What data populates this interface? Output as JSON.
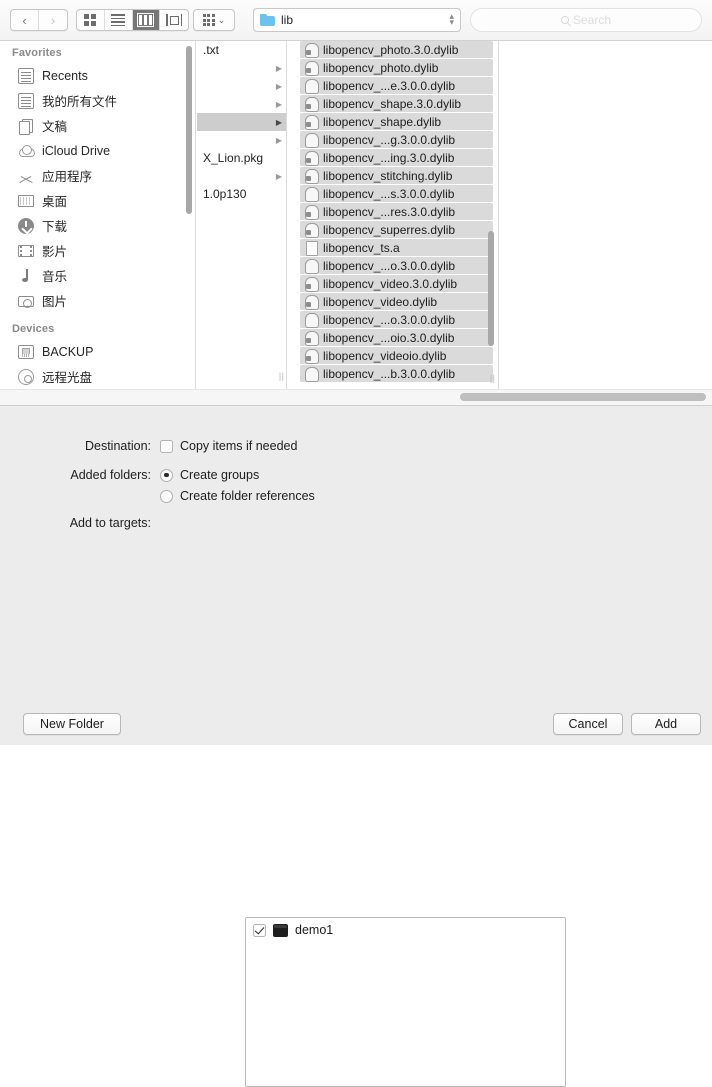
{
  "toolbar": {
    "nav": [
      {
        "name": "back-button",
        "glyph": "‹",
        "enabled": true
      },
      {
        "name": "forward-button",
        "glyph": "›",
        "enabled": false
      }
    ],
    "view_modes": [
      {
        "name": "icon-view-button",
        "icon": "icon-grid-icon",
        "selected": false
      },
      {
        "name": "list-view-button",
        "icon": "list-lines-icon",
        "selected": false
      },
      {
        "name": "column-view-button",
        "icon": "columns-icon",
        "selected": true
      },
      {
        "name": "coverflow-view-button",
        "icon": "coverflow-icon",
        "selected": false
      }
    ],
    "action_menu": {
      "name": "action-menu-button",
      "icon": "grid-dots-icon",
      "caret": "⌄"
    },
    "path": {
      "label": "lib",
      "icon": "folder-icon",
      "stepper_up": "▴",
      "stepper_down": "▾"
    },
    "search": {
      "placeholder": "Search",
      "icon": "search-icon"
    }
  },
  "sidebar": {
    "sections": [
      {
        "header": "Favorites",
        "items": [
          {
            "label": "Recents",
            "icon": "recents-icon",
            "shape": "gi-clock"
          },
          {
            "label": "我的所有文件",
            "icon": "all-files-icon",
            "shape": "gi-docs"
          },
          {
            "label": "文稿",
            "icon": "documents-icon",
            "shape": "gi-doc"
          },
          {
            "label": "iCloud Drive",
            "icon": "icloud-drive-icon",
            "shape": "gi-cloud"
          },
          {
            "label": "应用程序",
            "icon": "applications-icon",
            "shape": "gi-app"
          },
          {
            "label": "桌面",
            "icon": "desktop-icon",
            "shape": "gi-desk"
          },
          {
            "label": "下载",
            "icon": "downloads-icon",
            "shape": "gi-dl"
          },
          {
            "label": "影片",
            "icon": "movies-icon",
            "shape": "gi-movie"
          },
          {
            "label": "音乐",
            "icon": "music-icon",
            "shape": "gi-music"
          },
          {
            "label": "图片",
            "icon": "pictures-icon",
            "shape": "gi-pic"
          }
        ]
      },
      {
        "header": "Devices",
        "items": [
          {
            "label": "BACKUP",
            "icon": "hard-disk-icon",
            "shape": "gi-disk"
          },
          {
            "label": "远程光盘",
            "icon": "remote-disc-icon",
            "shape": "gi-cd"
          }
        ]
      }
    ]
  },
  "column_two": {
    "rows": [
      {
        "label": ".txt",
        "arrow": "",
        "selected": false
      },
      {
        "label": "",
        "arrow": "▶",
        "selected": false
      },
      {
        "label": "",
        "arrow": "▶",
        "selected": false
      },
      {
        "label": "",
        "arrow": "▶",
        "selected": false
      },
      {
        "label": "",
        "arrow": "▶",
        "selected": true
      },
      {
        "label": "",
        "arrow": "▶",
        "selected": false
      },
      {
        "label": "X_Lion.pkg",
        "arrow": "",
        "selected": false
      },
      {
        "label": "",
        "arrow": "▶",
        "selected": false
      },
      {
        "label": "1.0p130",
        "arrow": "",
        "selected": false
      }
    ]
  },
  "file_list": {
    "items": [
      {
        "name": "libopencv_photo.3.0.dylib",
        "icon": "dylib-icon"
      },
      {
        "name": "libopencv_photo.dylib",
        "icon": "dylib-icon"
      },
      {
        "name": "libopencv_...e.3.0.0.dylib",
        "icon": "dylib-alias-icon"
      },
      {
        "name": "libopencv_shape.3.0.dylib",
        "icon": "dylib-icon"
      },
      {
        "name": "libopencv_shape.dylib",
        "icon": "dylib-icon"
      },
      {
        "name": "libopencv_...g.3.0.0.dylib",
        "icon": "dylib-alias-icon"
      },
      {
        "name": "libopencv_...ing.3.0.dylib",
        "icon": "dylib-icon"
      },
      {
        "name": "libopencv_stitching.dylib",
        "icon": "dylib-icon"
      },
      {
        "name": "libopencv_...s.3.0.0.dylib",
        "icon": "dylib-alias-icon"
      },
      {
        "name": "libopencv_...res.3.0.dylib",
        "icon": "dylib-icon"
      },
      {
        "name": "libopencv_superres.dylib",
        "icon": "dylib-icon"
      },
      {
        "name": "libopencv_ts.a",
        "icon": "archive-doc-icon"
      },
      {
        "name": "libopencv_...o.3.0.0.dylib",
        "icon": "dylib-alias-icon"
      },
      {
        "name": "libopencv_video.3.0.dylib",
        "icon": "dylib-icon"
      },
      {
        "name": "libopencv_video.dylib",
        "icon": "dylib-icon"
      },
      {
        "name": "libopencv_...o.3.0.0.dylib",
        "icon": "dylib-alias-icon"
      },
      {
        "name": "libopencv_...oio.3.0.dylib",
        "icon": "dylib-icon"
      },
      {
        "name": "libopencv_videoio.dylib",
        "icon": "dylib-icon"
      },
      {
        "name": "libopencv_...b.3.0.0.dylib",
        "icon": "dylib-alias-icon"
      }
    ]
  },
  "form": {
    "destination": {
      "label": "Destination:",
      "checkbox_label": "Copy items if needed",
      "checked": false
    },
    "added_folders": {
      "label": "Added folders:",
      "options": [
        {
          "label": "Create groups",
          "selected": true
        },
        {
          "label": "Create folder references",
          "selected": false
        }
      ]
    },
    "add_to_targets": {
      "label": "Add to targets:",
      "targets": [
        {
          "name": "demo1",
          "checked": true,
          "icon": "app-target-icon"
        }
      ]
    }
  },
  "footer": {
    "new_folder_label": "New Folder",
    "cancel_label": "Cancel",
    "add_label": "Add"
  }
}
